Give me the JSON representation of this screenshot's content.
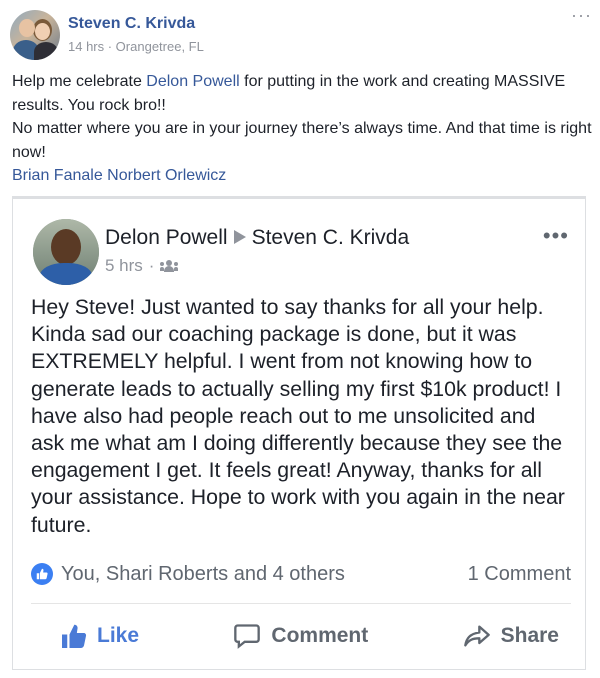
{
  "post": {
    "author": "Steven C. Krivda",
    "meta": "14 hrs · Orangetree, FL",
    "more_icon": "more-horizontal-icon",
    "text": {
      "line1_pre": "Help me celebrate ",
      "line1_link": "Delon Powell",
      "line1_post": " for putting in the work and creating MASSIVE results. You rock bro!!",
      "line2": "No matter where you are in your journey there’s always time. And that time is right now!",
      "tagged": "Brian Fanale Norbert Orlewicz"
    }
  },
  "shared": {
    "author": "Delon Powell",
    "recipient": "Steven C. Krivda",
    "time": "5 hrs",
    "dot": "·",
    "audience_icon": "friends-icon",
    "body": "Hey Steve!  Just wanted to say thanks for all your help.  Kinda sad our coaching package is done, but it was EXTREMELY helpful.  I went from not knowing how to generate leads to actually selling my first $10k product!  I have also had people reach out to me unsolicited and ask me what am I doing differently because they see the engagement I get.  It feels great!  Anyway, thanks for all your assistance.  Hope to work with you again in the near future.",
    "reactions_text": "You, Shari Roberts and 4 others",
    "comments_text": "1 Comment",
    "actions": {
      "like": "Like",
      "comment": "Comment",
      "share": "Share"
    }
  },
  "colors": {
    "link": "#365899",
    "meta": "#90949c",
    "like_active": "#4a7ad6",
    "badge": "#3b7ff2"
  }
}
